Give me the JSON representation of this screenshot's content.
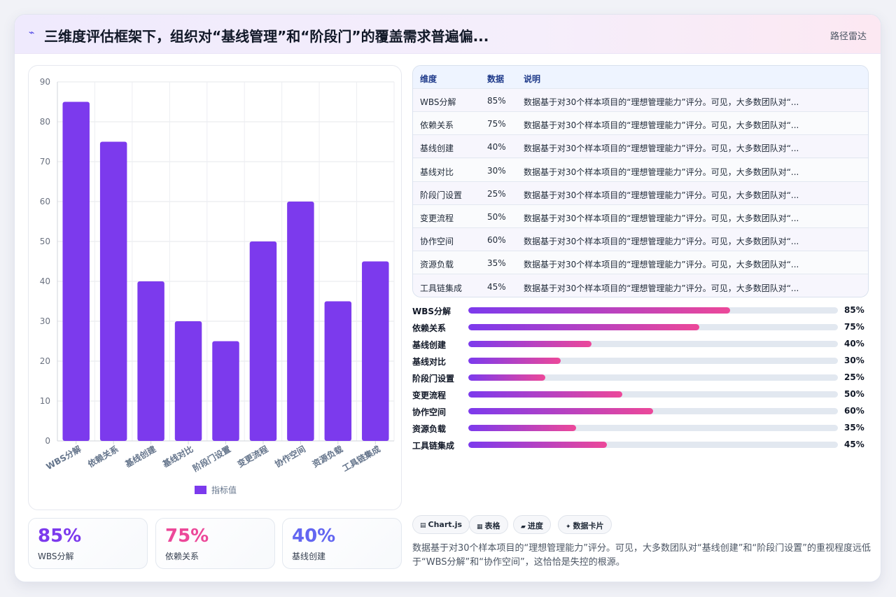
{
  "header": {
    "logo_icon": "spark-icon",
    "logo_glyph": "⌁",
    "title": "三维度评估框架下，组织对“基线管理”和“阶段门”的覆盖需求普遍偏...",
    "badge": "路径雷达"
  },
  "chart_data": {
    "type": "bar",
    "categories": [
      "WBS分解",
      "依赖关系",
      "基线创建",
      "基线对比",
      "阶段门设置",
      "变更流程",
      "协作空间",
      "资源负载",
      "工具链集成"
    ],
    "series": [
      {
        "name": "指标值",
        "values": [
          85,
          75,
          40,
          30,
          25,
          50,
          60,
          35,
          45
        ],
        "color": "#7c3aed"
      }
    ],
    "ylim": [
      0,
      90
    ],
    "yticks": [
      0,
      10,
      20,
      30,
      40,
      50,
      60,
      70,
      80,
      90
    ],
    "grid": true,
    "legend": "bottom"
  },
  "stats": [
    {
      "value": "85%",
      "label": "WBS分解",
      "color": "#7c3aed"
    },
    {
      "value": "75%",
      "label": "依赖关系",
      "color": "#ec4899"
    },
    {
      "value": "40%",
      "label": "基线创建",
      "color": "#6366f1"
    }
  ],
  "table": {
    "headers": [
      "维度",
      "数据",
      "说明"
    ],
    "rows": [
      [
        "WBS分解",
        "85%",
        "数据基于对30个样本项目的“理想管理能力”评分。可见，大多数团队对“..."
      ],
      [
        "依赖关系",
        "75%",
        "数据基于对30个样本项目的“理想管理能力”评分。可见，大多数团队对“..."
      ],
      [
        "基线创建",
        "40%",
        "数据基于对30个样本项目的“理想管理能力”评分。可见，大多数团队对“..."
      ],
      [
        "基线对比",
        "30%",
        "数据基于对30个样本项目的“理想管理能力”评分。可见，大多数团队对“..."
      ],
      [
        "阶段门设置",
        "25%",
        "数据基于对30个样本项目的“理想管理能力”评分。可见，大多数团队对“..."
      ],
      [
        "变更流程",
        "50%",
        "数据基于对30个样本项目的“理想管理能力”评分。可见，大多数团队对“..."
      ],
      [
        "协作空间",
        "60%",
        "数据基于对30个样本项目的“理想管理能力”评分。可见，大多数团队对“..."
      ],
      [
        "资源负载",
        "35%",
        "数据基于对30个样本项目的“理想管理能力”评分。可见，大多数团队对“..."
      ],
      [
        "工具链集成",
        "45%",
        "数据基于对30个样本项目的“理想管理能力”评分。可见，大多数团队对“..."
      ]
    ]
  },
  "progress": [
    {
      "label": "WBS分解",
      "value": 85,
      "text": "85%"
    },
    {
      "label": "依赖关系",
      "value": 75,
      "text": "75%"
    },
    {
      "label": "基线创建",
      "value": 40,
      "text": "40%"
    },
    {
      "label": "基线对比",
      "value": 30,
      "text": "30%"
    },
    {
      "label": "阶段门设置",
      "value": 25,
      "text": "25%"
    },
    {
      "label": "变更流程",
      "value": 50,
      "text": "50%"
    },
    {
      "label": "协作空间",
      "value": 60,
      "text": "60%"
    },
    {
      "label": "资源负载",
      "value": 35,
      "text": "35%"
    },
    {
      "label": "工具链集成",
      "value": 45,
      "text": "45%"
    }
  ],
  "chips": [
    {
      "icon": "chart-icon",
      "glyph": "▤",
      "label": "Chart.js"
    },
    {
      "icon": "table-icon",
      "glyph": "▦",
      "label": "表格"
    },
    {
      "icon": "progress-icon",
      "glyph": "▰",
      "label": "进度"
    },
    {
      "icon": "card-icon",
      "glyph": "✦",
      "label": "数据卡片"
    }
  ],
  "summary": "数据基于对30个样本项目的“理想管理能力”评分。可见，大多数团队对“基线创建”和“阶段门设置”的重视程度远低于“WBS分解”和“协作空间”，这恰恰是失控的根源。"
}
